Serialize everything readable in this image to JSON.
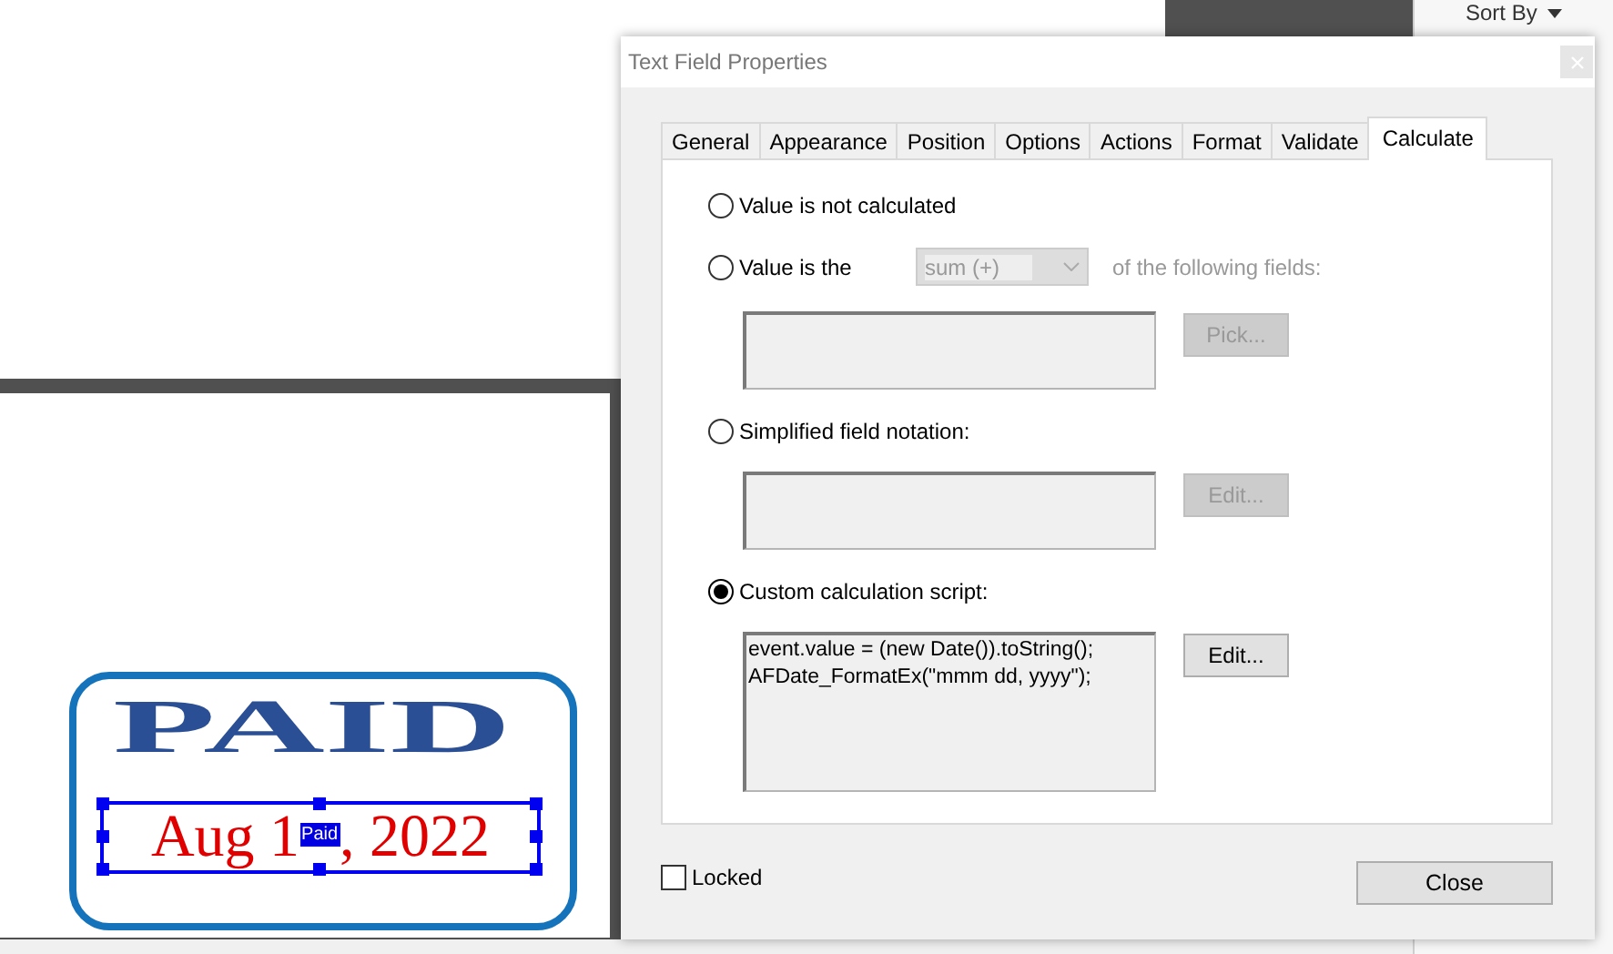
{
  "sidebar": {
    "sort_label": "Sort By"
  },
  "stamp": {
    "title": "PAID",
    "field_value_parts": [
      "Aug 1",
      ", 2022"
    ],
    "field_tag": "Paid",
    "selected": true
  },
  "dialog": {
    "title": "Text Field Properties",
    "tabs": [
      {
        "label": "General",
        "selected": false
      },
      {
        "label": "Appearance",
        "selected": false
      },
      {
        "label": "Position",
        "selected": false
      },
      {
        "label": "Options",
        "selected": false
      },
      {
        "label": "Actions",
        "selected": false
      },
      {
        "label": "Format",
        "selected": false
      },
      {
        "label": "Validate",
        "selected": false
      },
      {
        "label": "Calculate",
        "selected": true
      }
    ],
    "options": [
      {
        "kind": "plain",
        "label": "Value is not calculated",
        "selected": false
      },
      {
        "kind": "aggregate",
        "label": "Value is the",
        "selected": false,
        "dropdown": {
          "value": "sum (+)",
          "disabled": true
        },
        "suffix": "of the following fields:",
        "button": {
          "label": "Pick...",
          "disabled": true
        }
      },
      {
        "kind": "notation",
        "label": "Simplified field notation:",
        "selected": false,
        "button": {
          "label": "Edit...",
          "disabled": true
        }
      },
      {
        "kind": "script",
        "label": "Custom calculation script:",
        "selected": true,
        "lines": [
          "event.value = (new Date()).toString();",
          "AFDate_FormatEx(\"mmm dd, yyyy\");"
        ],
        "button": {
          "label": "Edit...",
          "disabled": false
        }
      }
    ],
    "locked": {
      "label": "Locked",
      "checked": false
    },
    "close_button": "Close"
  }
}
